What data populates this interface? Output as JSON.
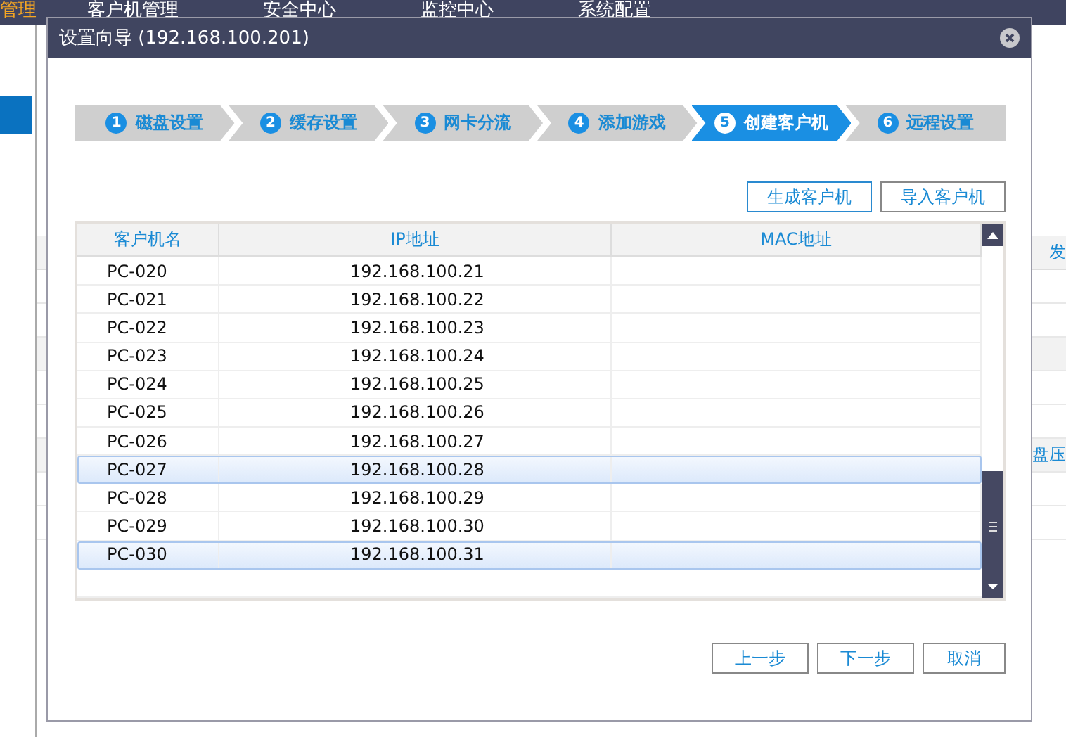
{
  "app_nav": {
    "items": [
      {
        "label": "管理",
        "selected": true
      },
      {
        "label": "客户机管理",
        "selected": false
      },
      {
        "label": "安全中心",
        "selected": false
      },
      {
        "label": "监控中心",
        "selected": false
      },
      {
        "label": "系统配置",
        "selected": false
      }
    ]
  },
  "background_panel": {
    "header_text": "发",
    "row_text": "盘压"
  },
  "dialog": {
    "title": "设置向导 (192.168.100.201)",
    "steps": [
      {
        "number": "1",
        "label": "磁盘设置",
        "selected": false
      },
      {
        "number": "2",
        "label": "缓存设置",
        "selected": false
      },
      {
        "number": "3",
        "label": "网卡分流",
        "selected": false
      },
      {
        "number": "4",
        "label": "添加游戏",
        "selected": false
      },
      {
        "number": "5",
        "label": "创建客户机",
        "selected": true
      },
      {
        "number": "6",
        "label": "远程设置",
        "selected": false
      }
    ],
    "actions": [
      {
        "label": "生成客户机",
        "focused": true
      },
      {
        "label": "导入客户机",
        "focused": false
      }
    ],
    "table": {
      "columns": [
        "客户机名",
        "IP地址",
        "MAC地址"
      ],
      "rows": [
        {
          "name": "PC-020",
          "ip": "192.168.100.21",
          "selected": false
        },
        {
          "name": "PC-021",
          "ip": "192.168.100.22",
          "selected": false
        },
        {
          "name": "PC-022",
          "ip": "192.168.100.23",
          "selected": false
        },
        {
          "name": "PC-023",
          "ip": "192.168.100.24",
          "selected": false
        },
        {
          "name": "PC-024",
          "ip": "192.168.100.25",
          "selected": false
        },
        {
          "name": "PC-025",
          "ip": "192.168.100.26",
          "selected": false
        },
        {
          "name": "PC-026",
          "ip": "192.168.100.27",
          "selected": false
        },
        {
          "name": "PC-027",
          "ip": "192.168.100.28",
          "selected": true
        },
        {
          "name": "PC-028",
          "ip": "192.168.100.29",
          "selected": false
        },
        {
          "name": "PC-029",
          "ip": "192.168.100.30",
          "selected": false
        },
        {
          "name": "PC-030",
          "ip": "192.168.100.31",
          "selected": true
        }
      ]
    },
    "buttons": [
      "上一步",
      "下一步",
      "取消"
    ]
  }
}
